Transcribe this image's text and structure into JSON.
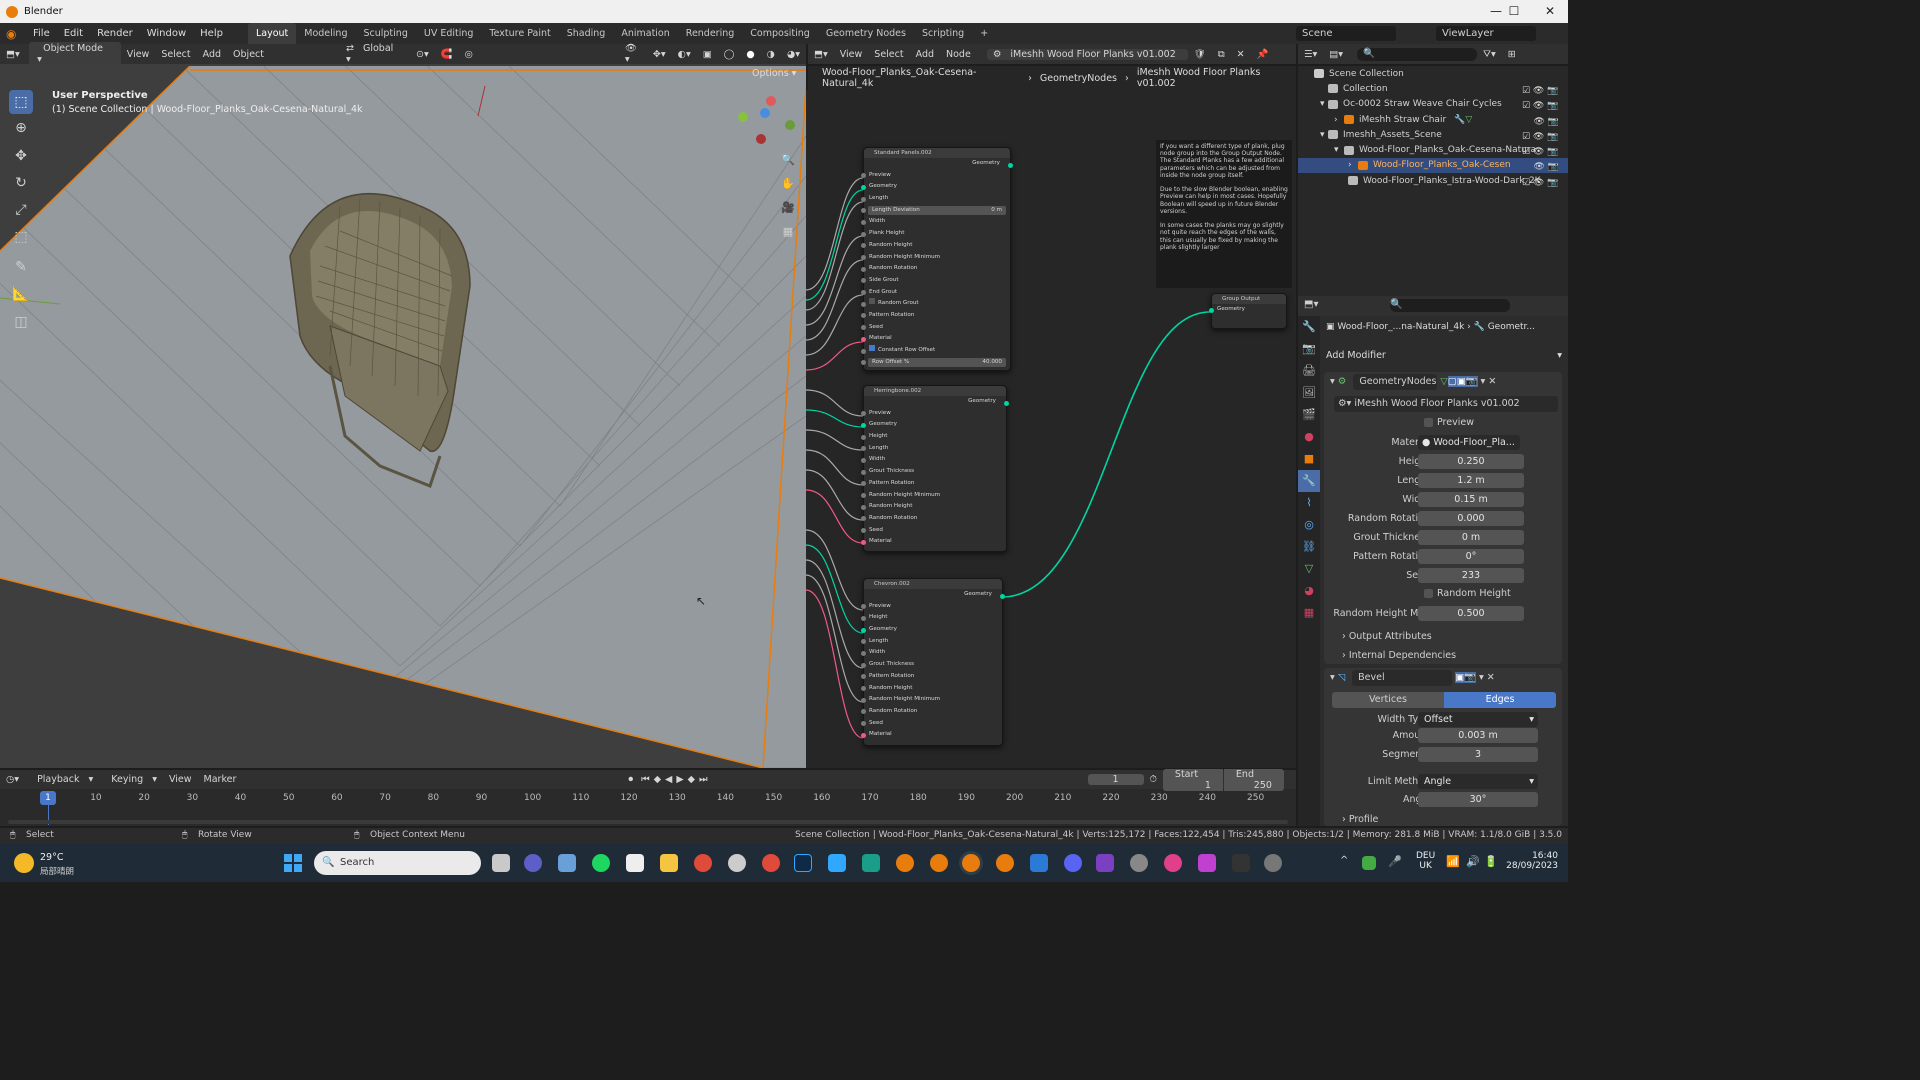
{
  "window": {
    "title": "Blender",
    "minimize": "—",
    "maximize": "☐",
    "close": "✕"
  },
  "menu": [
    "File",
    "Edit",
    "Render",
    "Window",
    "Help"
  ],
  "workspaces": [
    "Layout",
    "Modeling",
    "Sculpting",
    "UV Editing",
    "Texture Paint",
    "Shading",
    "Animation",
    "Rendering",
    "Compositing",
    "Geometry Nodes",
    "Scripting",
    "+"
  ],
  "active_workspace": "Layout",
  "scene": {
    "label": "Scene",
    "view_layer": "ViewLayer"
  },
  "viewport": {
    "mode": "Object Mode",
    "menus": [
      "View",
      "Select",
      "Add",
      "Object"
    ],
    "transform": "Global",
    "options": "Options",
    "perspective": "User Perspective",
    "collection_info": "(1) Scene Collection | Wood-Floor_Planks_Oak-Cesena-Natural_4k"
  },
  "node_editor": {
    "menus": [
      "View",
      "Select",
      "Add",
      "Node"
    ],
    "tree_name": "iMeshh Wood Floor Planks v01.002",
    "breadcrumb": [
      "Wood-Floor_Planks_Oak-Cesena-Natural_4k",
      "GeometryNodes",
      "iMeshh Wood Floor Planks v01.002"
    ],
    "note": "If you want a different type of plank, plug node group into the Group Output Node. The Standard Planks has a few additional parameters which can be adjusted from inside the node group itself.\n\nDue to the slow Blender boolean, enabling Preview can help in most cases. Hopefully Boolean will speed up in future Blender versions.\n\nIn some cases the planks may go slightly not quite reach the edges of the walls, this can usually be fixed by making the plank slightly larger",
    "group_output": {
      "title": "Group Output",
      "input": "Geometry"
    },
    "nodes": [
      {
        "title": "Standard Panels.002",
        "output": "Geometry",
        "inputs": [
          "Preview",
          "Geometry",
          "Length",
          "Length Deviation",
          "Width",
          "Plank Height",
          "Random Height",
          "Random Height Minimum",
          "Random Rotation",
          "Side Grout",
          "End Grout",
          "Random Grout",
          "Pattern Rotation",
          "Seed",
          "Material",
          "Constant Row Offset",
          "Row Offset %"
        ],
        "length_deviation": "0 m",
        "row_offset": "40.000"
      },
      {
        "title": "Herringbone.002",
        "output": "Geometry",
        "inputs": [
          "Preview",
          "Geometry",
          "Height",
          "Length",
          "Width",
          "Grout Thickness",
          "Pattern Rotation",
          "Random Height Minimum",
          "Random Height",
          "Random Rotation",
          "Seed",
          "Material"
        ]
      },
      {
        "title": "Chevron.002",
        "output": "Geometry",
        "inputs": [
          "Preview",
          "Height",
          "Geometry",
          "Length",
          "Width",
          "Grout Thickness",
          "Pattern Rotation",
          "Random Height",
          "Random Height Minimum",
          "Random Rotation",
          "Seed",
          "Material"
        ]
      }
    ]
  },
  "outliner": {
    "items": [
      {
        "label": "Scene Collection",
        "depth": 0
      },
      {
        "label": "Collection",
        "depth": 1
      },
      {
        "label": "Oc-0002 Straw Weave Chair Cycles",
        "depth": 1
      },
      {
        "label": "iMeshh Straw Chair",
        "depth": 2
      },
      {
        "label": "Imeshh_Assets_Scene",
        "depth": 1
      },
      {
        "label": "Wood-Floor_Planks_Oak-Cesena-Natura",
        "depth": 2
      },
      {
        "label": "Wood-Floor_Planks_Oak-Cesen",
        "depth": 3
      },
      {
        "label": "Wood-Floor_Planks_Istra-Wood-Dark_2K",
        "depth": 2
      }
    ]
  },
  "properties": {
    "breadcrumb": [
      "Wood-Floor_...na-Natural_4k",
      "Geometr..."
    ],
    "add_modifier": "Add Modifier",
    "gn_modifier": {
      "name": "GeometryNodes",
      "tree": "iMeshh Wood Floor Planks v01.002",
      "preview": "Preview",
      "material_label": "Material",
      "material": "Wood-Floor_Pla...",
      "params": [
        {
          "label": "Height",
          "value": "0.250"
        },
        {
          "label": "Length",
          "value": "1.2 m"
        },
        {
          "label": "Width",
          "value": "0.15 m"
        },
        {
          "label": "Random Rotation",
          "value": "0.000"
        },
        {
          "label": "Grout Thickness",
          "value": "0 m"
        },
        {
          "label": "Pattern Rotation",
          "value": "0°"
        },
        {
          "label": "Seed",
          "value": "233"
        }
      ],
      "random_height": "Random Height",
      "random_height_min_label": "Random Height Mi...",
      "random_height_min": "0.500",
      "output_attributes": "Output Attributes",
      "internal_dependencies": "Internal Dependencies"
    },
    "bevel": {
      "name": "Bevel",
      "tabs": [
        "Vertices",
        "Edges"
      ],
      "width_type_label": "Width Type",
      "width_type": "Offset",
      "amount_label": "Amount",
      "amount": "0.003 m",
      "segments_label": "Segments",
      "segments": "3",
      "limit_label": "Limit Method",
      "limit": "Angle",
      "angle_label": "Angle",
      "angle": "30°",
      "profile": "Profile"
    }
  },
  "timeline": {
    "menus": [
      "Playback",
      "Keying",
      "View",
      "Marker"
    ],
    "current": "1",
    "start_label": "Start",
    "start": "1",
    "end_label": "End",
    "end": "250",
    "ticks": [
      "10",
      "20",
      "30",
      "40",
      "50",
      "60",
      "70",
      "80",
      "90",
      "100",
      "110",
      "120",
      "130",
      "140",
      "150",
      "160",
      "170",
      "180",
      "190",
      "200",
      "210",
      "220",
      "230",
      "240",
      "250"
    ]
  },
  "status": {
    "select": "Select",
    "rotate": "Rotate View",
    "context": "Object Context Menu",
    "stats": "Scene Collection | Wood-Floor_Planks_Oak-Cesena-Natural_4k | Verts:125,172 | Faces:122,454 | Tris:245,880 | Objects:1/2 | Memory: 281.8 MiB | VRAM: 1.1/8.0 GiB | 3.5.0"
  },
  "taskbar": {
    "weather_temp": "29°C",
    "weather_desc": "局部晴朗",
    "search": "Search",
    "lang": "DEU",
    "region": "UK",
    "time": "16:40",
    "date": "28/09/2023"
  }
}
